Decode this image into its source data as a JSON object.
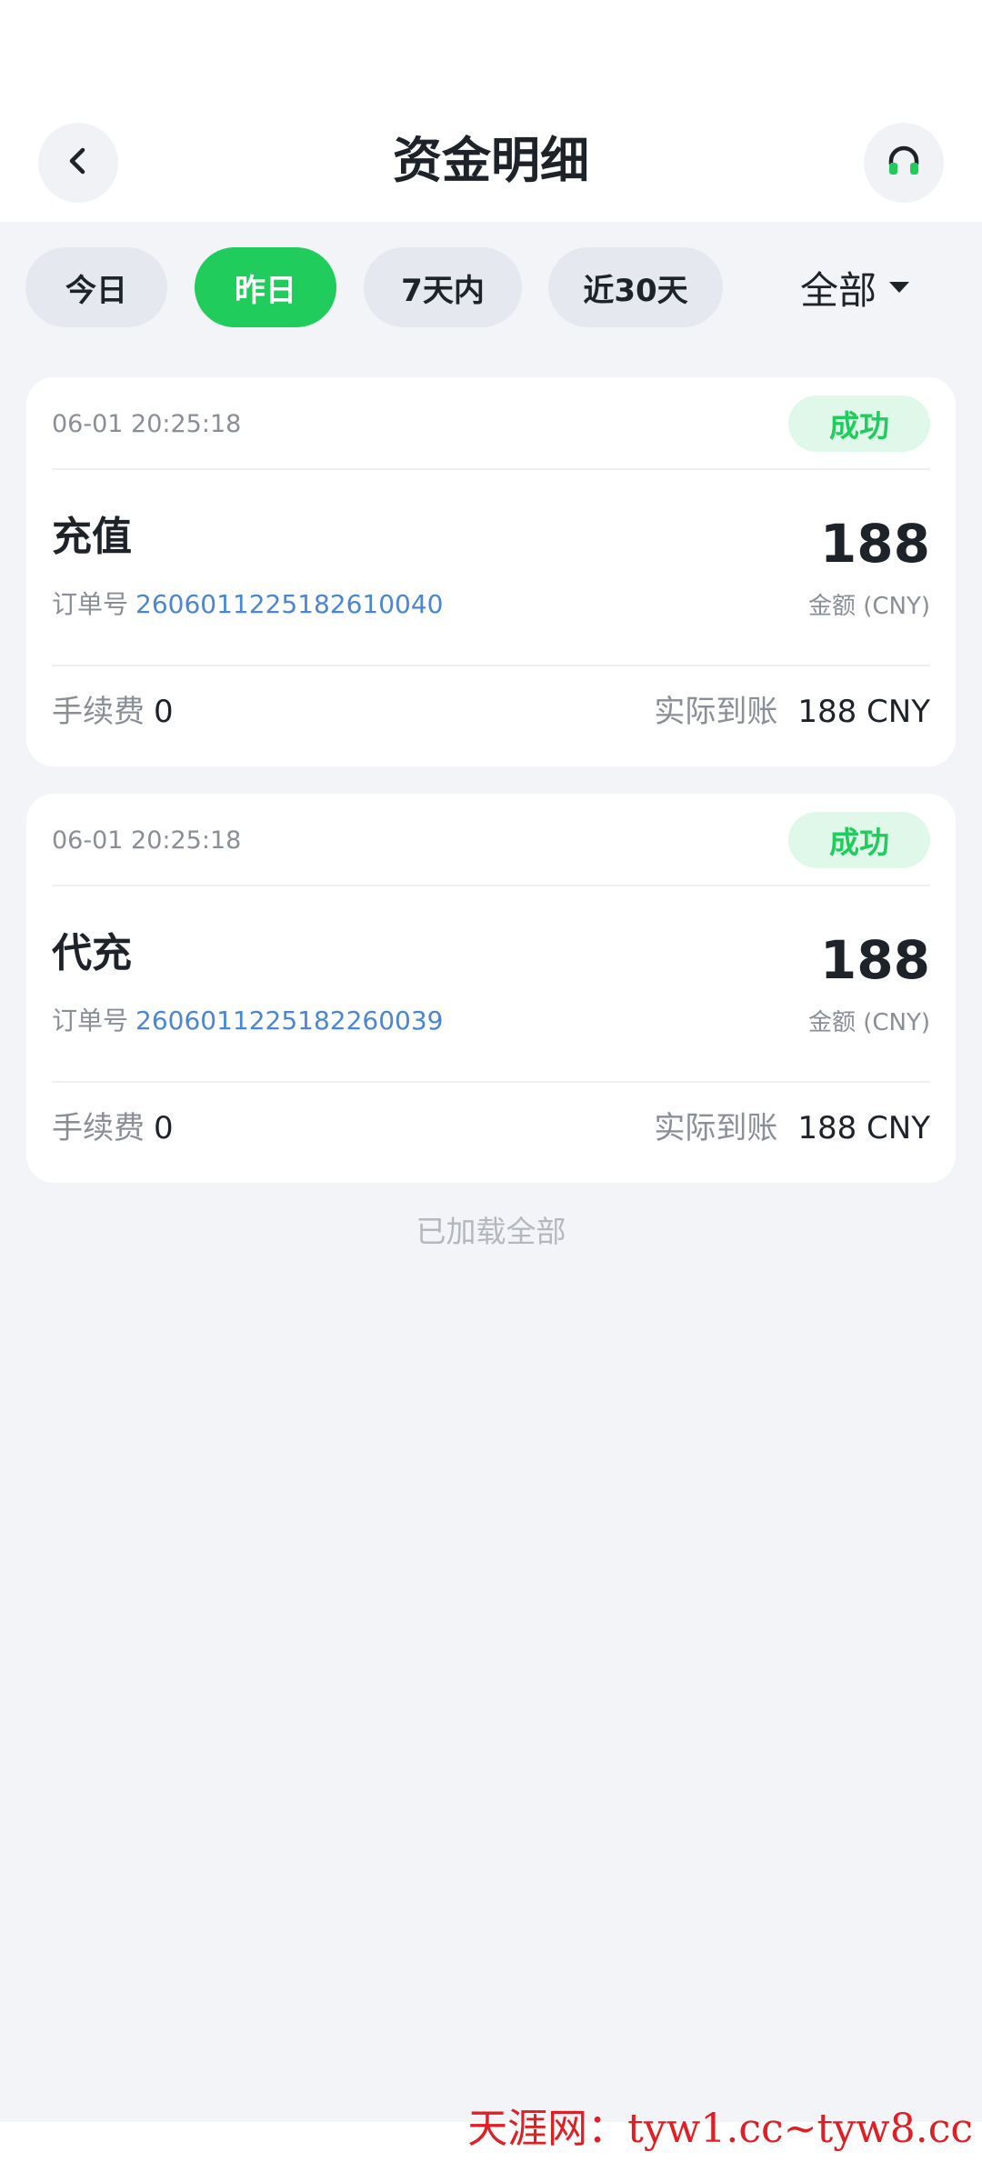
{
  "header": {
    "title": "资金明细",
    "back_icon": "chevron-left-icon",
    "support_icon": "headset-icon"
  },
  "filters": {
    "chips": [
      "今日",
      "昨日",
      "7天内",
      "近30天"
    ],
    "active": "昨日",
    "type_select": "全部"
  },
  "records": [
    {
      "time": "06-01 20:25:18",
      "status": "成功",
      "type": "充值",
      "order_label": "订单号",
      "order_no": "2606011225182610040",
      "amount": "188",
      "amount_label": "金额 (CNY)",
      "fee_label": "手续费",
      "fee": "0",
      "received_label": "实际到账",
      "received": "188 CNY"
    },
    {
      "time": "06-01 20:25:18",
      "status": "成功",
      "type": "代充",
      "order_label": "订单号",
      "order_no": "2606011225182260039",
      "amount": "188",
      "amount_label": "金额 (CNY)",
      "fee_label": "手续费",
      "fee": "0",
      "received_label": "实际到账",
      "received": "188 CNY"
    }
  ],
  "footer": {
    "loaded_all": "已加载全部"
  },
  "watermark": "天涯网：tyw1.cc~tyw8.cc",
  "colors": {
    "accent": "#1fcc5c",
    "success_bg": "#e0f8ea",
    "link": "#4a86d4",
    "background": "#f3f4f8"
  }
}
